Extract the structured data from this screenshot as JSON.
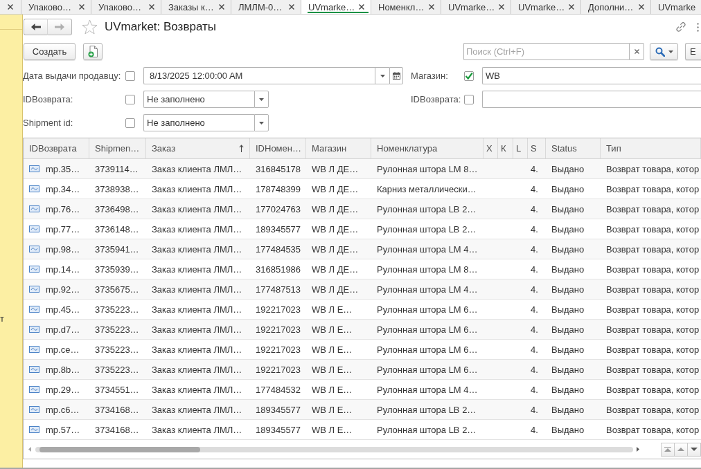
{
  "tabs": [
    {
      "kind": "clipped_left",
      "selected": false
    },
    {
      "kind": "full",
      "label": "Упаково…",
      "selected": false
    },
    {
      "kind": "full",
      "label": "Упаково…",
      "selected": false
    },
    {
      "kind": "full",
      "label": "Заказы к…",
      "selected": false
    },
    {
      "kind": "full",
      "label": "ЛМЛМ-0…",
      "selected": false
    },
    {
      "kind": "full",
      "label": "UVmarke…",
      "selected": true
    },
    {
      "kind": "full",
      "label": "Номенкл…",
      "selected": false
    },
    {
      "kind": "full",
      "label": "UVmarke…",
      "selected": false
    },
    {
      "kind": "full",
      "label": "UVmarke…",
      "selected": false
    },
    {
      "kind": "full",
      "label": "Дополни…",
      "selected": false
    },
    {
      "kind": "clipped_right",
      "label": "UVmarke",
      "selected": false
    }
  ],
  "sidebar": {
    "text": "т"
  },
  "form": {
    "title": "UVmarket: Возвраты",
    "favorite": false,
    "back_disabled": false,
    "forward_disabled": true
  },
  "toolbar": {
    "create_button": "Создать",
    "search": {
      "placeholder": "Поиск (Ctrl+F)"
    },
    "more_button": "Е"
  },
  "filters": {
    "left": [
      {
        "label": "Дата выдачи продавцу:",
        "checked": false,
        "kind": "date",
        "value": "8/13/2025 12:00:00 AM"
      },
      {
        "label": "IDВозврата:",
        "checked": false,
        "kind": "select",
        "value": "Не заполнено"
      },
      {
        "label": "Shipment id:",
        "checked": false,
        "kind": "select",
        "value": "Не заполнено"
      }
    ],
    "right": [
      {
        "label": "Магазин:",
        "checked": true,
        "kind": "text",
        "value": "WB"
      },
      {
        "label": "IDВозврата:",
        "checked": false,
        "kind": "text"
      }
    ]
  },
  "table": {
    "columns": [
      {
        "label": "IDВозврата",
        "sorted": false
      },
      {
        "label": "Shipmen…",
        "sorted": false
      },
      {
        "label": "Заказ",
        "sorted": true
      },
      {
        "label": "IDНомен…",
        "sorted": false
      },
      {
        "label": "Магазин",
        "sorted": false
      },
      {
        "label": "Номенклатура",
        "sorted": false
      },
      {
        "label": "Х",
        "sorted": false
      },
      {
        "label": "К",
        "sorted": false
      },
      {
        "label": "L",
        "sorted": false
      },
      {
        "label": "S",
        "sorted": false
      },
      {
        "label": "Status",
        "sorted": false
      },
      {
        "label": "Тип",
        "sorted": false
      }
    ],
    "rows": [
      {
        "id": "mp.35…",
        "shipment_id": "3739114…",
        "order": "Заказ клиента ЛМЛ…",
        "nomenclature_id": "316845178",
        "store": "WB Л ДЕ…",
        "nomenclature": "Рулонная штора LM 8…",
        "s": "4.",
        "status": "Выдано",
        "type": "Возврат товара, котор"
      },
      {
        "id": "mp.34…",
        "shipment_id": "3738938…",
        "order": "Заказ клиента ЛМЛ…",
        "nomenclature_id": "178748399",
        "store": "WB Л ДЕ…",
        "nomenclature": "Карниз металлически…",
        "s": "4.",
        "status": "Выдано",
        "type": "Возврат товара, котор"
      },
      {
        "id": "mp.76…",
        "shipment_id": "3736498…",
        "order": "Заказ клиента ЛМЛ…",
        "nomenclature_id": "177024763",
        "store": "WB Л ДЕ…",
        "nomenclature": "Рулонная штора LB 2…",
        "s": "4.",
        "status": "Выдано",
        "type": "Возврат товара, котор"
      },
      {
        "id": "mp.77…",
        "shipment_id": "3736148…",
        "order": "Заказ клиента ЛМЛ…",
        "nomenclature_id": "189345577",
        "store": "WB Л ДЕ…",
        "nomenclature": "Рулонная штора LB 2…",
        "s": "4.",
        "status": "Выдано",
        "type": "Возврат товара, котор"
      },
      {
        "id": "mp.98…",
        "shipment_id": "3735941…",
        "order": "Заказ клиента ЛМЛ…",
        "nomenclature_id": "177484535",
        "store": "WB Л ДЕ…",
        "nomenclature": "Рулонная штора LM 4…",
        "s": "4.",
        "status": "Выдано",
        "type": "Возврат товара, котор"
      },
      {
        "id": "mp.14…",
        "shipment_id": "3735939…",
        "order": "Заказ клиента ЛМЛ…",
        "nomenclature_id": "316851986",
        "store": "WB Л ДЕ…",
        "nomenclature": "Рулонная штора LM 8…",
        "s": "4.",
        "status": "Выдано",
        "type": "Возврат товара, котор"
      },
      {
        "id": "mp.92…",
        "shipment_id": "3735675…",
        "order": "Заказ клиента ЛМЛ…",
        "nomenclature_id": "177487513",
        "store": "WB Л ДЕ…",
        "nomenclature": "Рулонная штора LM 4…",
        "s": "4.",
        "status": "Выдано",
        "type": "Возврат товара, котор"
      },
      {
        "id": "mp.45…",
        "shipment_id": "3735223…",
        "order": "Заказ клиента ЛМЛ…",
        "nomenclature_id": "192217023",
        "store": "WB Л Е…",
        "nomenclature": "Рулонная штора LM 6…",
        "s": "4.",
        "status": "Выдано",
        "type": "Возврат товара, котор"
      },
      {
        "id": "mp.d7…",
        "shipment_id": "3735223…",
        "order": "Заказ клиента ЛМЛ…",
        "nomenclature_id": "192217023",
        "store": "WB Л Е…",
        "nomenclature": "Рулонная штора LM 6…",
        "s": "4.",
        "status": "Выдано",
        "type": "Возврат товара, котор"
      },
      {
        "id": "mp.ce…",
        "shipment_id": "3735223…",
        "order": "Заказ клиента ЛМЛ…",
        "nomenclature_id": "192217023",
        "store": "WB Л Е…",
        "nomenclature": "Рулонная штора LM 6…",
        "s": "4.",
        "status": "Выдано",
        "type": "Возврат товара, котор"
      },
      {
        "id": "mp.8b…",
        "shipment_id": "3735223…",
        "order": "Заказ клиента ЛМЛ…",
        "nomenclature_id": "192217023",
        "store": "WB Л Е…",
        "nomenclature": "Рулонная штора LM 6…",
        "s": "4.",
        "status": "Выдано",
        "type": "Возврат товара, котор"
      },
      {
        "id": "mp.29…",
        "shipment_id": "3734551…",
        "order": "Заказ клиента ЛМЛ…",
        "nomenclature_id": "177484532",
        "store": "WB Л Е…",
        "nomenclature": "Рулонная штора LM 4…",
        "s": "4.",
        "status": "Выдано",
        "type": "Возврат товара, котор"
      },
      {
        "id": "mp.c6…",
        "shipment_id": "3734168…",
        "order": "Заказ клиента ЛМЛ…",
        "nomenclature_id": "189345577",
        "store": "WB Л Е…",
        "nomenclature": "Рулонная штора LB 2…",
        "s": "4.",
        "status": "Выдано",
        "type": "Возврат товара, котор"
      },
      {
        "id": "mp.57…",
        "shipment_id": "3734168…",
        "order": "Заказ клиента ЛМЛ…",
        "nomenclature_id": "189345577",
        "store": "WB Л Е…",
        "nomenclature": "Рулонная штора LB 2…",
        "s": "4.",
        "status": "Выдано",
        "type": "Возврат товара, котор"
      }
    ]
  }
}
